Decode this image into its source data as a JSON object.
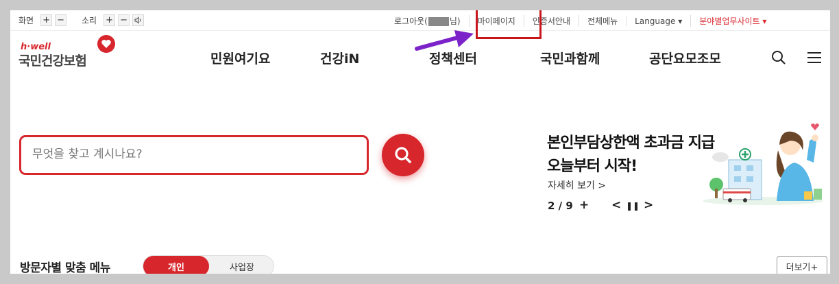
{
  "util": {
    "screen_label": "화면",
    "sound_label": "소리",
    "plus": "+",
    "minus": "−",
    "logout_prefix": "로그아웃(",
    "logout_suffix": "님)",
    "mypage": "마이페이지",
    "cert": "인증서안내",
    "allmenu": "전체메뉴",
    "language": "Language ▾",
    "sites": "분야별업무사이트 ▾"
  },
  "logo": {
    "brand_en": "h·well",
    "brand_kr": "국민건강보험"
  },
  "nav": [
    "민원여기요",
    "건강iN",
    "정책센터",
    "국민과함께",
    "공단요모조모"
  ],
  "search": {
    "placeholder": "무엇을 찾고 계시나요?"
  },
  "banner": {
    "title": "본인부담상한액 초과금 지급\n오늘부터 시작!",
    "more": "자세히 보기  >",
    "page": "2 / 9",
    "plus": "+",
    "prev": "<",
    "pause": "❚❚",
    "next": ">"
  },
  "bottom": {
    "title": "방문자별 맞춤 메뉴",
    "tab_on": "개인",
    "tab_off": "사업장",
    "more": "더보기+"
  },
  "colors": {
    "brand_red": "#d7262c",
    "annotation_red": "#c8151b",
    "annotation_arrow": "#7b22c9"
  }
}
